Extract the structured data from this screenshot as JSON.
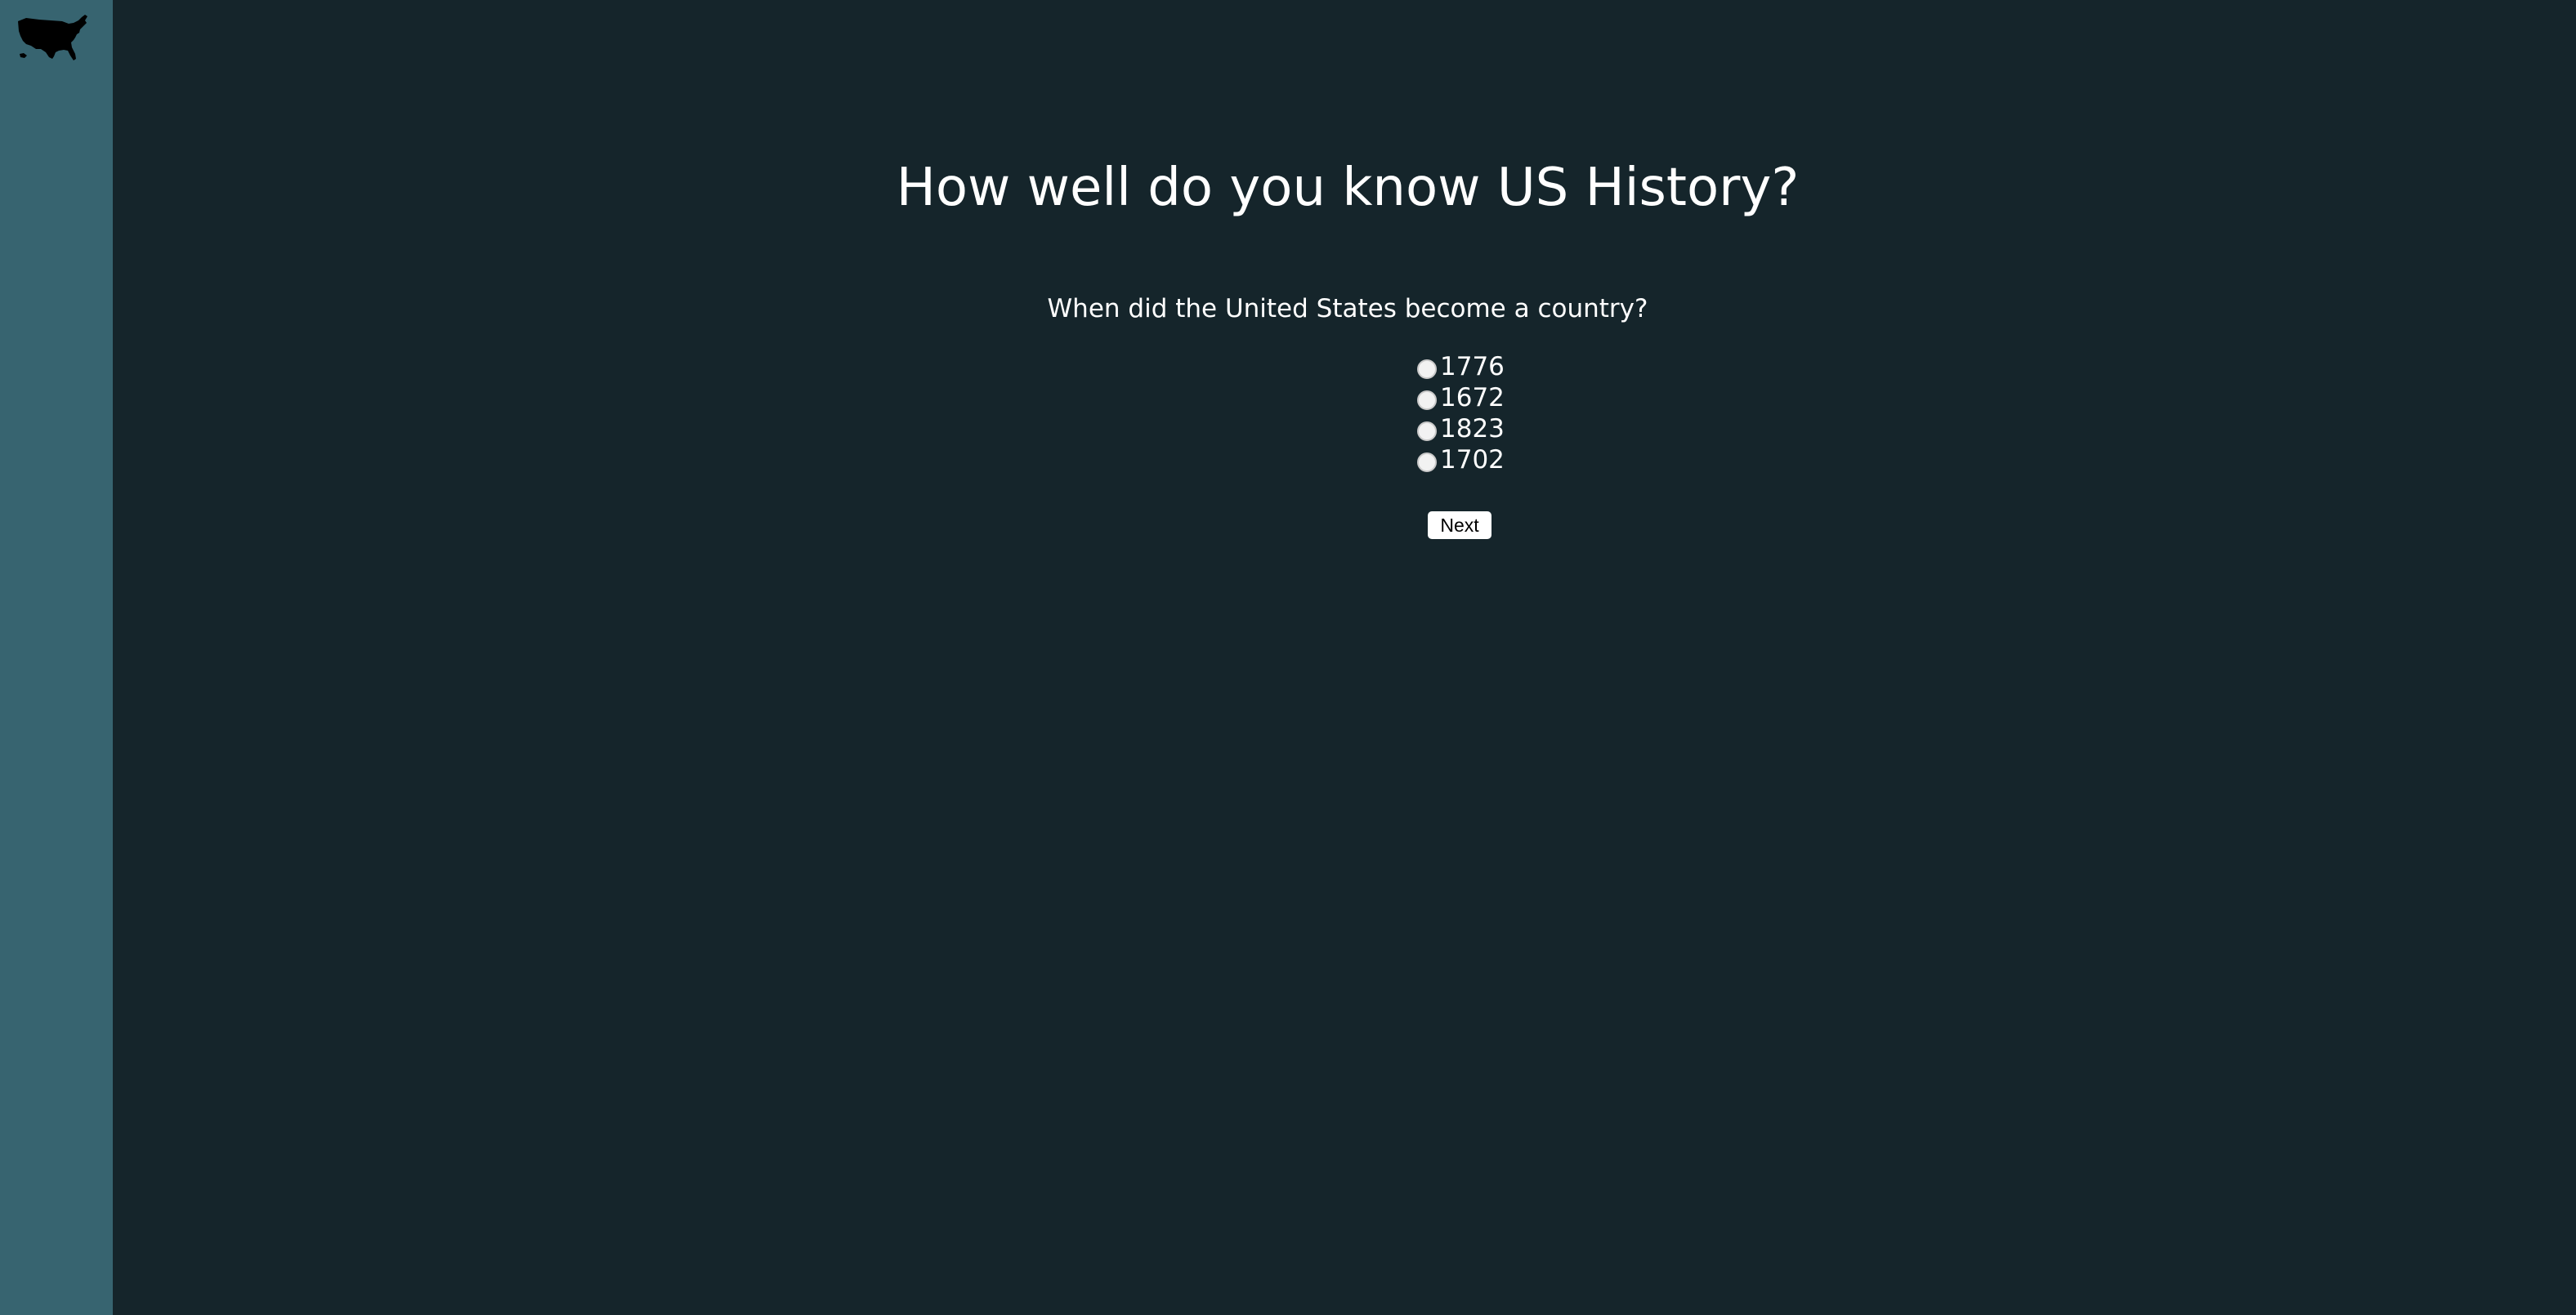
{
  "sidebar": {
    "logo_icon": "usa-map-icon",
    "background_color": "#376470"
  },
  "main": {
    "background_color": "#15252b",
    "title": "How well do you know US History?",
    "question": "When did the United States become a country?",
    "options": [
      {
        "label": "1776",
        "selected": false
      },
      {
        "label": "1672",
        "selected": false
      },
      {
        "label": "1823",
        "selected": false
      },
      {
        "label": "1702",
        "selected": false
      }
    ],
    "next_label": "Next"
  }
}
